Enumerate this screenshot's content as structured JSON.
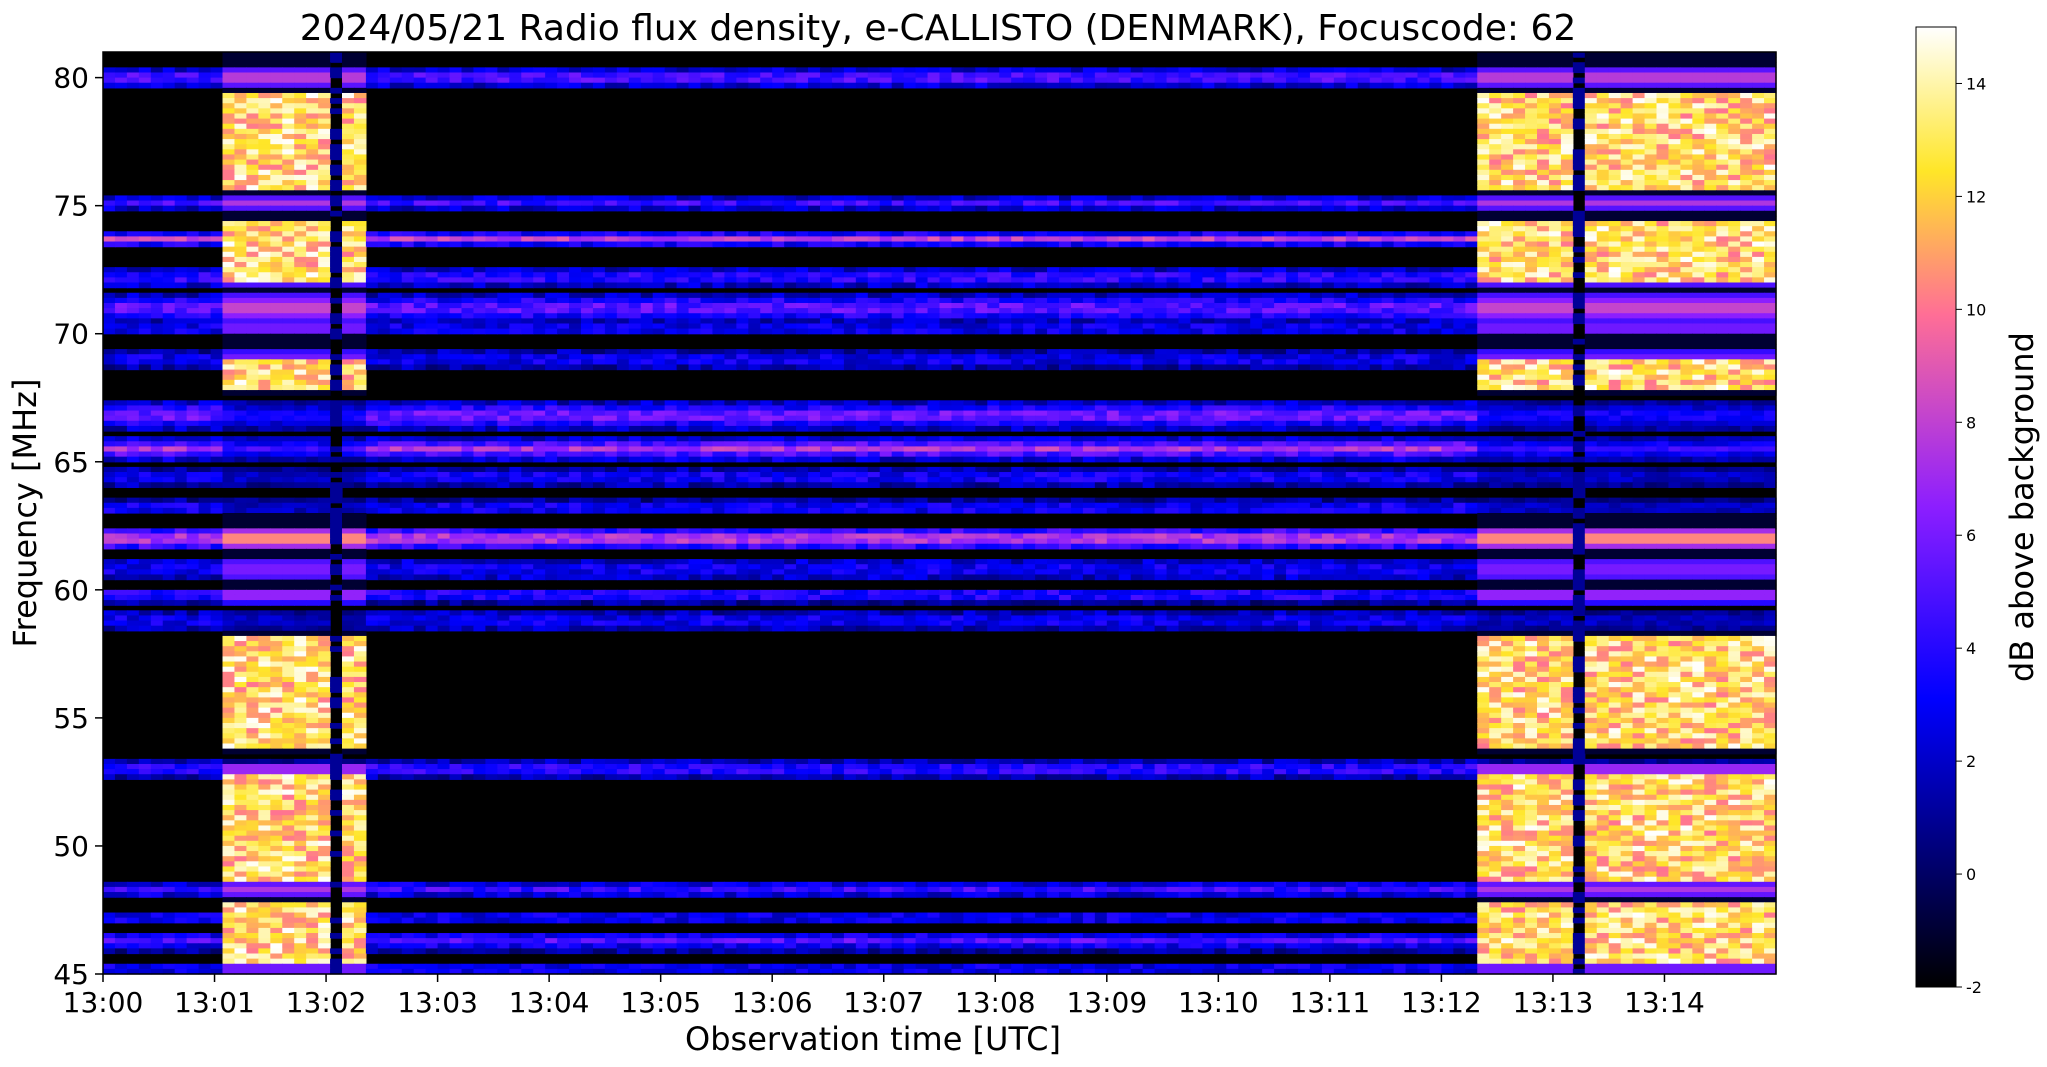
{
  "chart_data": {
    "type": "heatmap",
    "title": "2024/05/21  Radio flux density, e-CALLISTO (DENMARK), Focuscode: 62",
    "xlabel": "Observation time [UTC]",
    "ylabel": "Frequency [MHz]",
    "colorbar_label": "dB above background",
    "colormap": "gnuplot2",
    "x_tick_labels": [
      "13:00",
      "13:01",
      "13:02",
      "13:03",
      "13:04",
      "13:05",
      "13:06",
      "13:07",
      "13:08",
      "13:09",
      "13:10",
      "13:11",
      "13:12",
      "13:13",
      "13:14"
    ],
    "x_range_minutes": [
      0,
      15
    ],
    "y_ticks": [
      45,
      50,
      55,
      60,
      65,
      70,
      75,
      80
    ],
    "ylim": [
      45,
      81
    ],
    "colorbar_ticks": [
      -2,
      0,
      2,
      4,
      6,
      8,
      10,
      12,
      14
    ],
    "clim": [
      -2,
      15
    ],
    "bright_intervals_minutes": [
      [
        1.05,
        2.4
      ],
      [
        12.35,
        15.0
      ]
    ],
    "dropout_minutes": [
      2.05,
      13.25
    ],
    "bands": [
      {
        "freq": 80.0,
        "width": 0.6,
        "level": 5
      },
      {
        "freq": 75.1,
        "width": 0.4,
        "level": 3.5
      },
      {
        "freq": 73.7,
        "width": 0.4,
        "level": 7
      },
      {
        "freq": 72.2,
        "width": 0.6,
        "level": 4
      },
      {
        "freq": 71.0,
        "width": 1.0,
        "level": 5
      },
      {
        "freq": 70.2,
        "width": 0.3,
        "level": 3
      },
      {
        "freq": 69.0,
        "width": 0.5,
        "level": 2.5
      },
      {
        "freq": 66.8,
        "width": 1.0,
        "level": 5.5
      },
      {
        "freq": 65.5,
        "width": 0.8,
        "level": 6.5
      },
      {
        "freq": 64.4,
        "width": 0.5,
        "level": 3
      },
      {
        "freq": 63.2,
        "width": 0.4,
        "level": 3
      },
      {
        "freq": 62.0,
        "width": 0.8,
        "level": 8
      },
      {
        "freq": 60.8,
        "width": 0.8,
        "level": 2.5
      },
      {
        "freq": 59.8,
        "width": 0.4,
        "level": 4
      },
      {
        "freq": 58.8,
        "width": 0.6,
        "level": 2.5
      },
      {
        "freq": 53.0,
        "width": 0.5,
        "level": 4
      },
      {
        "freq": 48.3,
        "width": 0.5,
        "level": 3.5
      },
      {
        "freq": 47.2,
        "width": 0.3,
        "level": 3
      },
      {
        "freq": 46.3,
        "width": 0.6,
        "level": 4
      },
      {
        "freq": 45.2,
        "width": 0.3,
        "level": 3
      }
    ]
  }
}
